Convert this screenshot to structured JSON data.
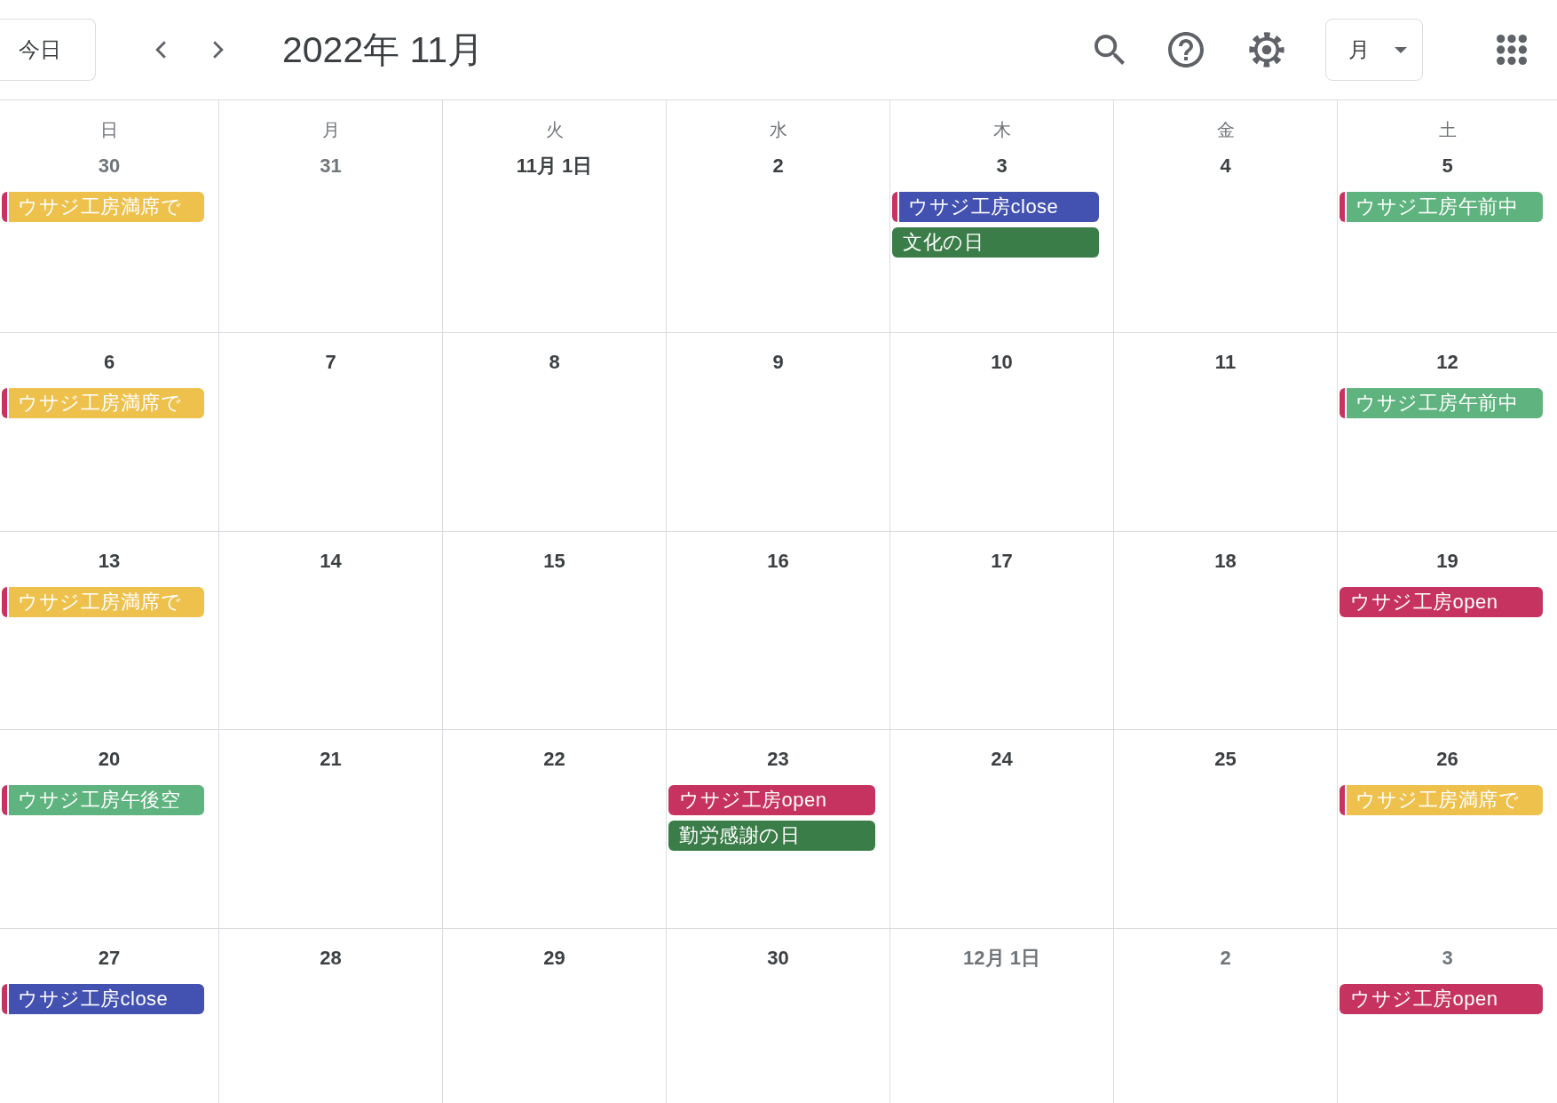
{
  "toolbar": {
    "today_button": "今日",
    "title": "2022年 11月",
    "view_selector": "月"
  },
  "weekdays": [
    "日",
    "月",
    "火",
    "水",
    "木",
    "金",
    "土"
  ],
  "weeks": [
    {
      "days": [
        {
          "date": "30",
          "outside_month": true,
          "events": [
            {
              "title": "ウサジ工房満席で",
              "color": "#eec14d",
              "stripe": true
            }
          ]
        },
        {
          "date": "31",
          "outside_month": true
        },
        {
          "date": "11月 1日",
          "outside_month": false
        },
        {
          "date": "2",
          "outside_month": false
        },
        {
          "date": "3",
          "outside_month": false,
          "events": [
            {
              "title": "ウサジ工房close",
              "color": "#4351b0",
              "stripe": true
            },
            {
              "title": "文化の日",
              "color": "#3a7d48",
              "stripe": false
            }
          ]
        },
        {
          "date": "4",
          "outside_month": false
        },
        {
          "date": "5",
          "outside_month": false,
          "events": [
            {
              "title": "ウサジ工房午前中",
              "color": "#5eb37e",
              "stripe": true
            }
          ]
        }
      ]
    },
    {
      "days": [
        {
          "date": "6",
          "outside_month": false,
          "events": [
            {
              "title": "ウサジ工房満席で",
              "color": "#eec14d",
              "stripe": true
            }
          ]
        },
        {
          "date": "7",
          "outside_month": false
        },
        {
          "date": "8",
          "outside_month": false
        },
        {
          "date": "9",
          "outside_month": false
        },
        {
          "date": "10",
          "outside_month": false
        },
        {
          "date": "11",
          "outside_month": false
        },
        {
          "date": "12",
          "outside_month": false,
          "events": [
            {
              "title": "ウサジ工房午前中",
              "color": "#5eb37e",
              "stripe": true
            }
          ]
        }
      ]
    },
    {
      "days": [
        {
          "date": "13",
          "outside_month": false,
          "events": [
            {
              "title": "ウサジ工房満席で",
              "color": "#eec14d",
              "stripe": true
            }
          ]
        },
        {
          "date": "14",
          "outside_month": false
        },
        {
          "date": "15",
          "outside_month": false
        },
        {
          "date": "16",
          "outside_month": false
        },
        {
          "date": "17",
          "outside_month": false
        },
        {
          "date": "18",
          "outside_month": false
        },
        {
          "date": "19",
          "outside_month": false,
          "events": [
            {
              "title": "ウサジ工房open",
              "color": "#c73360",
              "stripe": false
            }
          ]
        }
      ]
    },
    {
      "days": [
        {
          "date": "20",
          "outside_month": false,
          "events": [
            {
              "title": "ウサジ工房午後空",
              "color": "#5eb37e",
              "stripe": true
            }
          ]
        },
        {
          "date": "21",
          "outside_month": false
        },
        {
          "date": "22",
          "outside_month": false
        },
        {
          "date": "23",
          "outside_month": false,
          "events": [
            {
              "title": "ウサジ工房open",
              "color": "#c73360",
              "stripe": false
            },
            {
              "title": "勤労感謝の日",
              "color": "#3a7d48",
              "stripe": false
            }
          ]
        },
        {
          "date": "24",
          "outside_month": false
        },
        {
          "date": "25",
          "outside_month": false
        },
        {
          "date": "26",
          "outside_month": false,
          "events": [
            {
              "title": "ウサジ工房満席で",
              "color": "#eec14d",
              "stripe": true
            }
          ]
        }
      ]
    },
    {
      "days": [
        {
          "date": "27",
          "outside_month": false,
          "events": [
            {
              "title": "ウサジ工房close",
              "color": "#4351b0",
              "stripe": true
            }
          ]
        },
        {
          "date": "28",
          "outside_month": false
        },
        {
          "date": "29",
          "outside_month": false
        },
        {
          "date": "30",
          "outside_month": false
        },
        {
          "date": "12月 1日",
          "outside_month": true
        },
        {
          "date": "2",
          "outside_month": true
        },
        {
          "date": "3",
          "outside_month": true,
          "events": [
            {
              "title": "ウサジ工房open",
              "color": "#c73360",
              "stripe": false
            }
          ]
        }
      ]
    }
  ]
}
